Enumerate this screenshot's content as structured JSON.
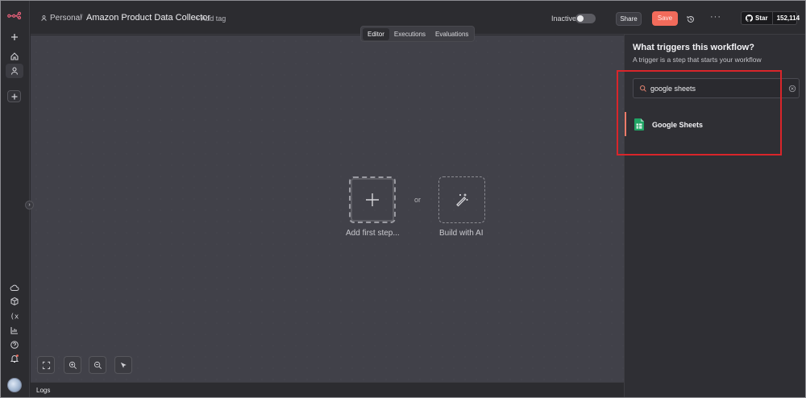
{
  "header": {
    "owner": "Personal",
    "separator": "/",
    "workflow_title": "Amazon Product Data Collector",
    "add_tag": "+ Add tag",
    "status_label": "Inactive",
    "share_label": "Share",
    "save_label": "Save",
    "more_label": "···",
    "github_star_label": "Star",
    "github_star_count": "152,114"
  },
  "tabs": [
    {
      "label": "Editor",
      "active": true
    },
    {
      "label": "Executions",
      "active": false
    },
    {
      "label": "Evaluations",
      "active": false
    }
  ],
  "canvas": {
    "add_first_step_label": "Add first step...",
    "or_label": "or",
    "build_ai_label": "Build with AI"
  },
  "logs": {
    "label": "Logs"
  },
  "panel": {
    "title": "What triggers this workflow?",
    "subtitle": "A trigger is a step that starts your workflow",
    "search_value": "google sheets",
    "results": [
      {
        "label": "Google Sheets",
        "icon": "google-sheets-icon"
      }
    ]
  },
  "colors": {
    "accent": "#f26b5b",
    "canvas": "#414149",
    "highlight_box": "#d9252a",
    "sheets_green": "#20a464"
  }
}
